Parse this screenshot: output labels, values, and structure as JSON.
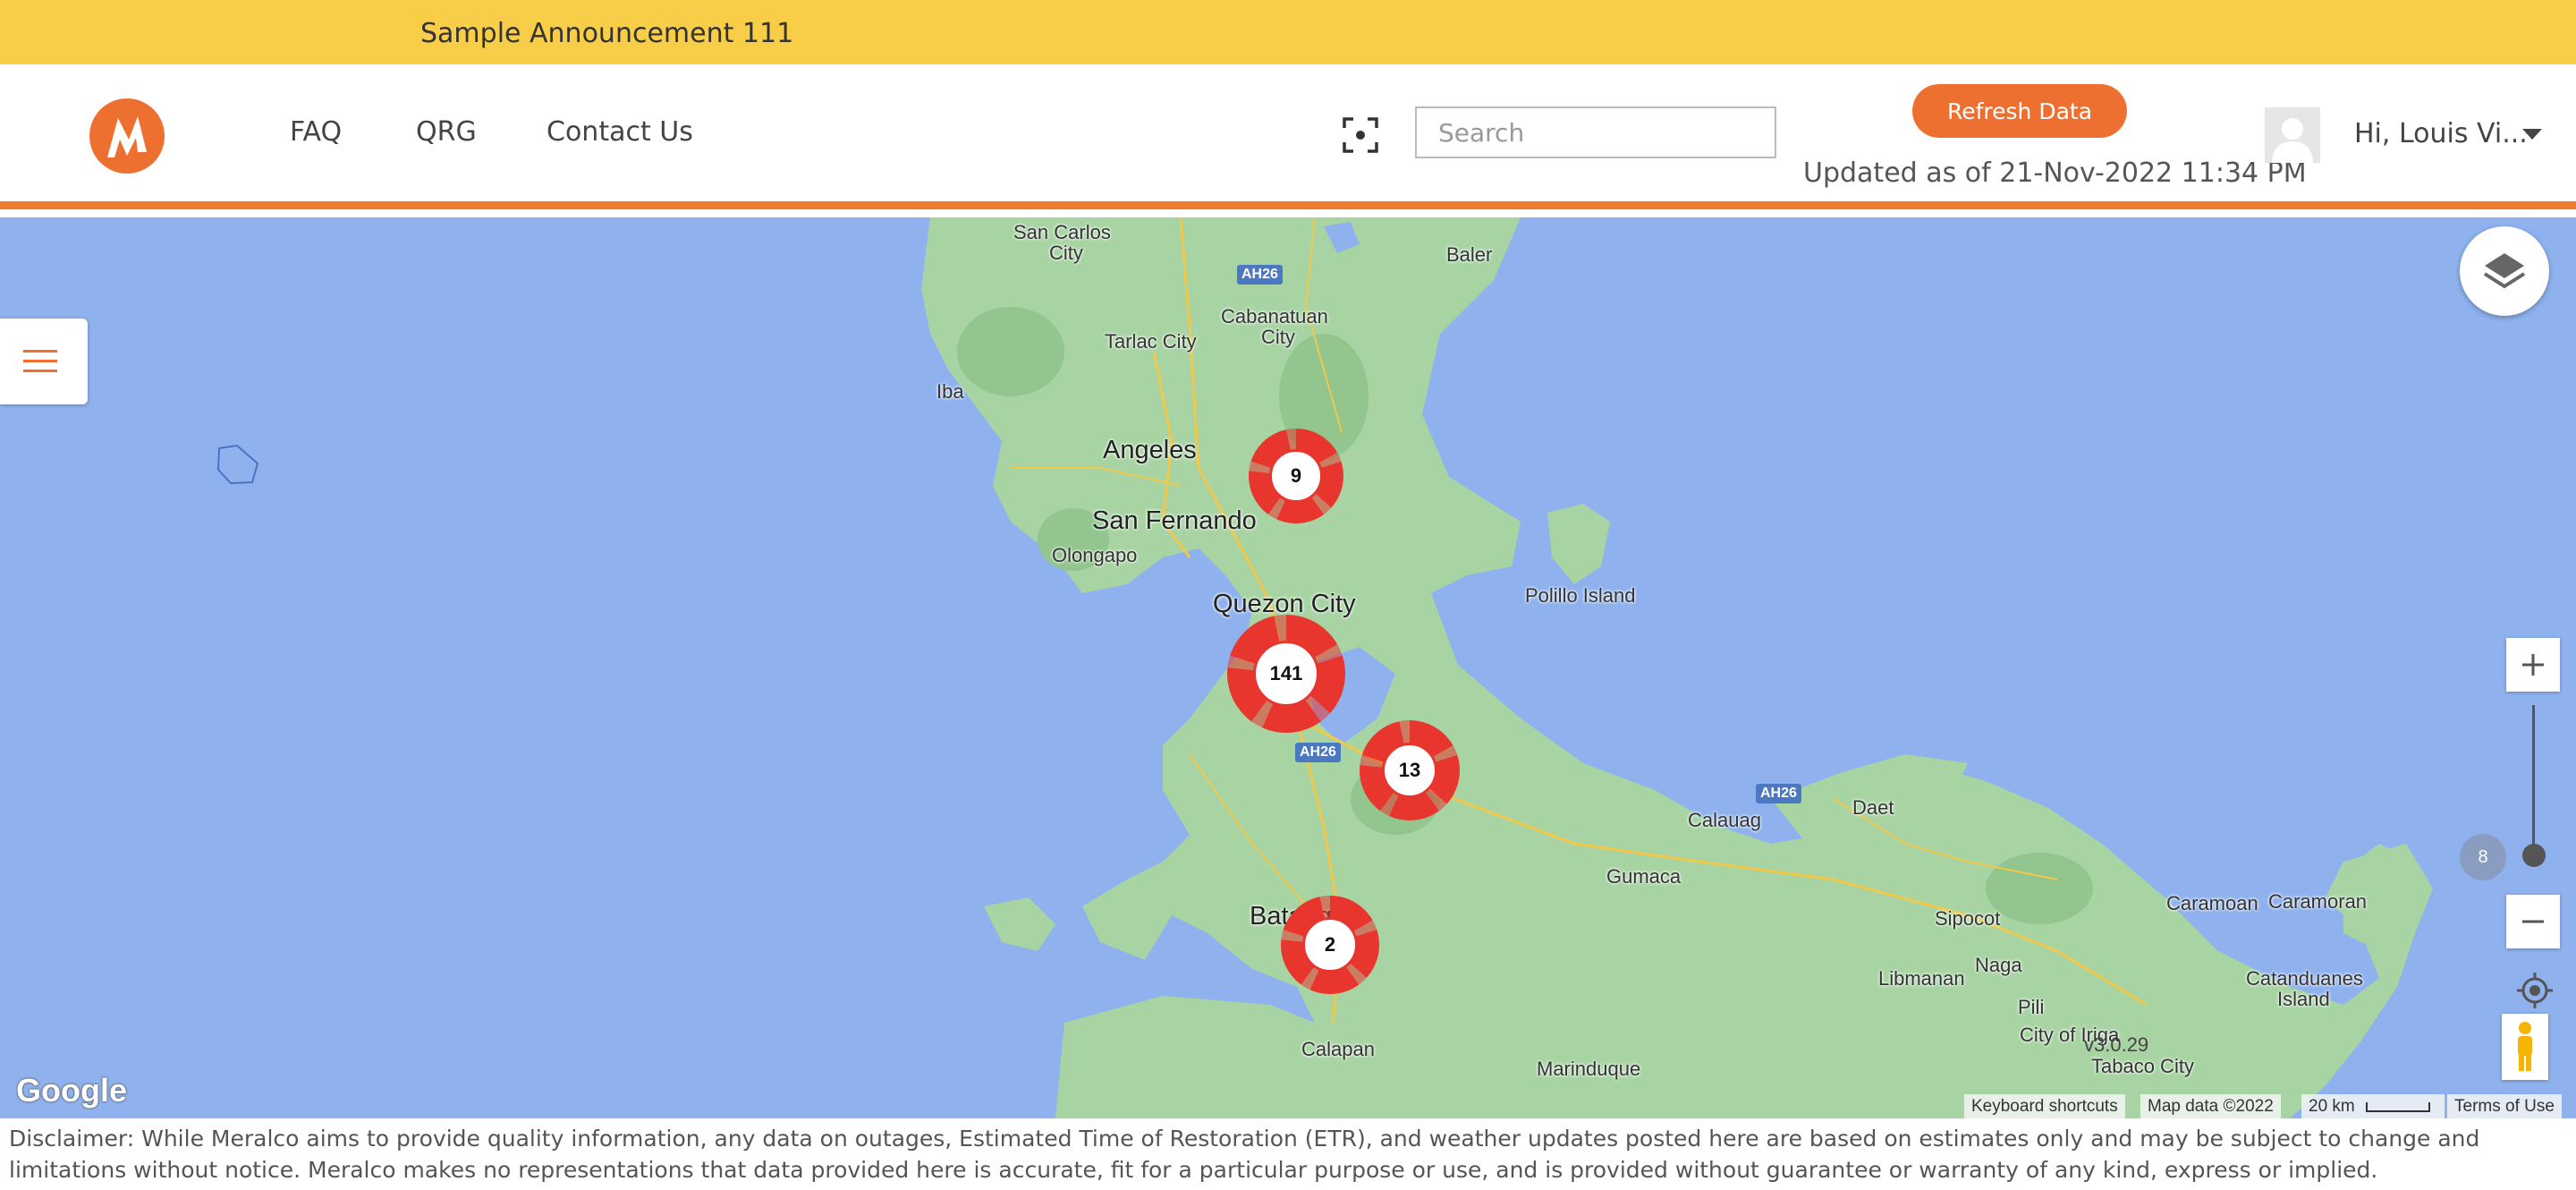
{
  "announcement": "Sample Announcement 111",
  "nav": {
    "faq": "FAQ",
    "qrg": "QRG",
    "contact": "Contact Us"
  },
  "search": {
    "placeholder": "Search",
    "value": ""
  },
  "refresh_label": "Refresh Data",
  "updated_text": "Updated as of 21-Nov-2022 11:34 PM",
  "user": {
    "greeting": "Hi, Louis Vi..."
  },
  "colors": {
    "accent": "#ee7030",
    "announcement_bg": "#f8cd47",
    "water": "#8fb2ee",
    "land": "#a8d4a4",
    "cluster": "#e8362e"
  },
  "map": {
    "labels": {
      "san_carlos": "San Carlos",
      "san_carlos_city": "City",
      "baler": "Baler",
      "cabanatuan": "Cabanatuan",
      "cabanatuan_city": "City",
      "tarlac": "Tarlac City",
      "iba": "Iba",
      "angeles": "Angeles",
      "san_fernando": "San Fernando",
      "olongapo": "Olongapo",
      "quezon": "Quezon City",
      "polillo": "Polillo Island",
      "calauag": "Calauag",
      "daet": "Daet",
      "gumaca": "Gumaca",
      "sipocot": "Sipocot",
      "caramoan1": "Caramoan",
      "caramoan2": "Caramoran",
      "naga": "Naga",
      "libmanan": "Libmanan",
      "catanduanes1": "Catanduanes",
      "catanduanes2": "Island",
      "pili": "Pili",
      "iriga": "City of Iriga",
      "tabaco": "Tabaco City",
      "batangas": "Batangas",
      "calapan": "Calapan",
      "marinduque": "Marinduque"
    },
    "shields": {
      "ah26_a": "AH26",
      "ah26_b": "AH26",
      "ah26_c": "AH26"
    },
    "clusters": [
      {
        "id": "c9",
        "count": "9"
      },
      {
        "id": "c141",
        "count": "141"
      },
      {
        "id": "c13",
        "count": "13"
      },
      {
        "id": "c2",
        "count": "2"
      }
    ],
    "zoom_level": "8",
    "version": "v3.0.29",
    "google_logo": "Google",
    "attribution": {
      "shortcuts": "Keyboard shortcuts",
      "mapdata": "Map data ©2022",
      "scale": "20 km",
      "terms": "Terms of Use"
    }
  },
  "disclaimer": "Disclaimer: While Meralco aims to provide quality information, any data on outages, Estimated Time of Restoration (ETR), and weather updates posted here are based on estimates only and may be subject to change and limitations without notice. Meralco makes no representations that data provided here is accurate, fit for a particular purpose or use, and is provided without guarantee or warranty of any kind, express or implied."
}
